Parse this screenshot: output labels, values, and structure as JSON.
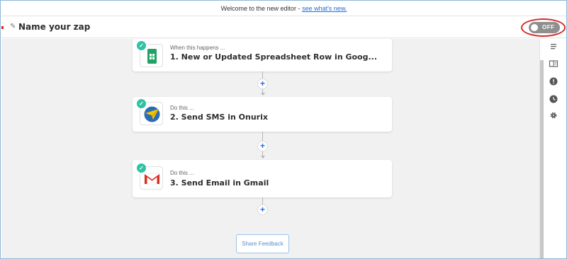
{
  "banner": {
    "text": "Welcome to the new editor - ",
    "link": "see what's new."
  },
  "header": {
    "zap_name": "Name your zap",
    "toggle_label": "OFF"
  },
  "steps": [
    {
      "sub": "When this happens ...",
      "title": "1. New or Updated Spreadsheet Row in Goog...",
      "app": "google-sheets"
    },
    {
      "sub": "Do this ...",
      "title": "2. Send SMS in Onurix",
      "app": "onurix"
    },
    {
      "sub": "Do this ...",
      "title": "3. Send Email in Gmail",
      "app": "gmail"
    }
  ],
  "sidebar": {
    "icons": [
      "list-icon",
      "panel-icon",
      "alert-icon",
      "clock-icon",
      "gear-icon"
    ]
  },
  "feedback": {
    "label": "Share Feedback"
  },
  "colors": {
    "check": "#2dc3a4",
    "plus": "#2b6de0",
    "annotation": "#d42b2b"
  }
}
